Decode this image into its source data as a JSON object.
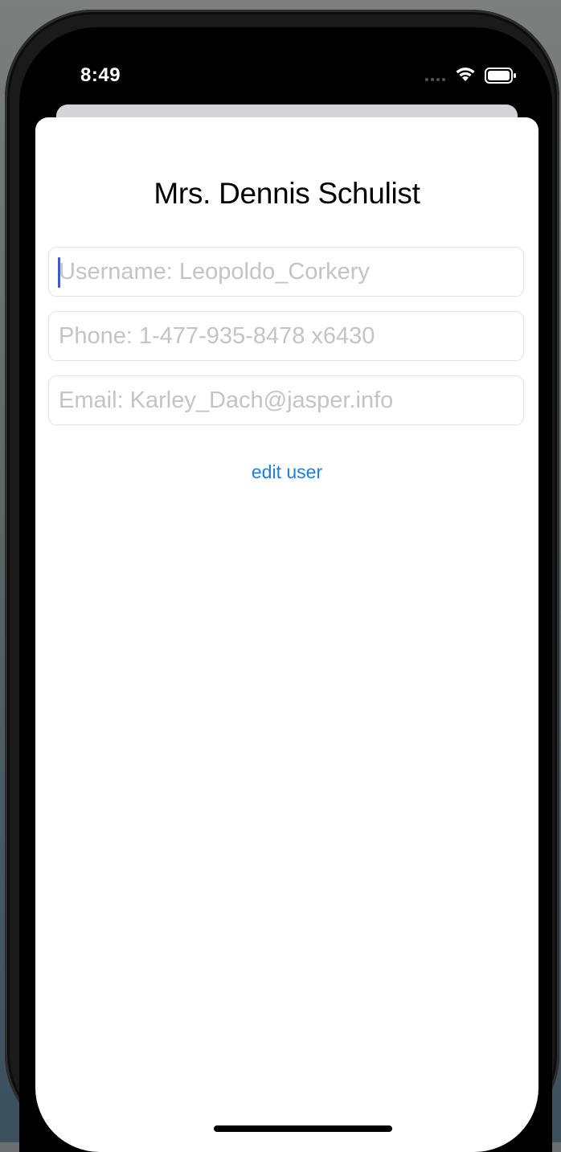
{
  "status_bar": {
    "time": "8:49",
    "icons": [
      "cellular-signal-icon",
      "wifi-icon",
      "battery-icon"
    ]
  },
  "user_form": {
    "title": "Mrs. Dennis Schulist",
    "username_placeholder": "Username: Leopoldo_Corkery",
    "phone_placeholder": "Phone: 1-477-935-8478 x6430",
    "email_placeholder": "Email: Karley_Dach@jasper.info",
    "edit_button_label": "edit user"
  },
  "colors": {
    "accent": "#1a7fe0",
    "caret": "#3b5bd6",
    "placeholder": "#c4c4c7",
    "sheet_background": "#ffffff",
    "field_border": "#e2e2e6"
  }
}
